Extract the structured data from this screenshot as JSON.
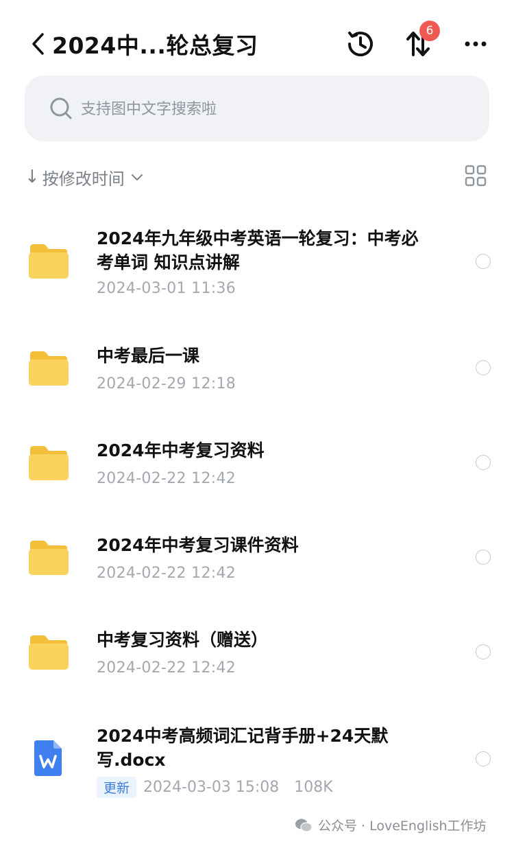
{
  "header": {
    "title": "2024中...轮总复习",
    "back_icon": "chevron-left-icon",
    "history_icon": "history-clock-icon",
    "transfer_icon": "transfer-arrows-icon",
    "transfer_badge": "6",
    "more_icon": "more-dots-icon",
    "badge_color": "#ee5a52"
  },
  "search": {
    "placeholder": "支持图中文字搜索啦"
  },
  "toolbar": {
    "sort_arrow": "↓",
    "sort_label": "按修改时间",
    "grid_icon": "grid-view-icon"
  },
  "files": [
    {
      "name": "2024年九年级中考英语一轮复习：中考必考单词 知识点讲解",
      "date": "2024-03-01 11:36",
      "icon": "folder-icon"
    },
    {
      "name": "中考最后一课",
      "date": "2024-02-29 12:18",
      "icon": "folder-icon"
    },
    {
      "name": "2024年中考复习资料",
      "date": "2024-02-22 12:42",
      "icon": "folder-icon"
    },
    {
      "name": "2024年中考复习课件资料",
      "date": "2024-02-22 12:42",
      "icon": "folder-icon"
    },
    {
      "name": "中考复习资料（赠送）",
      "date": "2024-02-22 12:42",
      "icon": "folder-icon"
    },
    {
      "name": "2024中考高频词汇记背手册+24天默写.docx",
      "tag": "更新",
      "date": "2024-03-03 15:08",
      "size": "108K",
      "icon": "word-doc-icon"
    }
  ],
  "watermark": {
    "text": "公众号 · LoveEnglish工作坊"
  },
  "colors": {
    "folder": "#f7c948",
    "doc_blue": "#3f7ff0",
    "search_bg": "#f0f2f6"
  }
}
